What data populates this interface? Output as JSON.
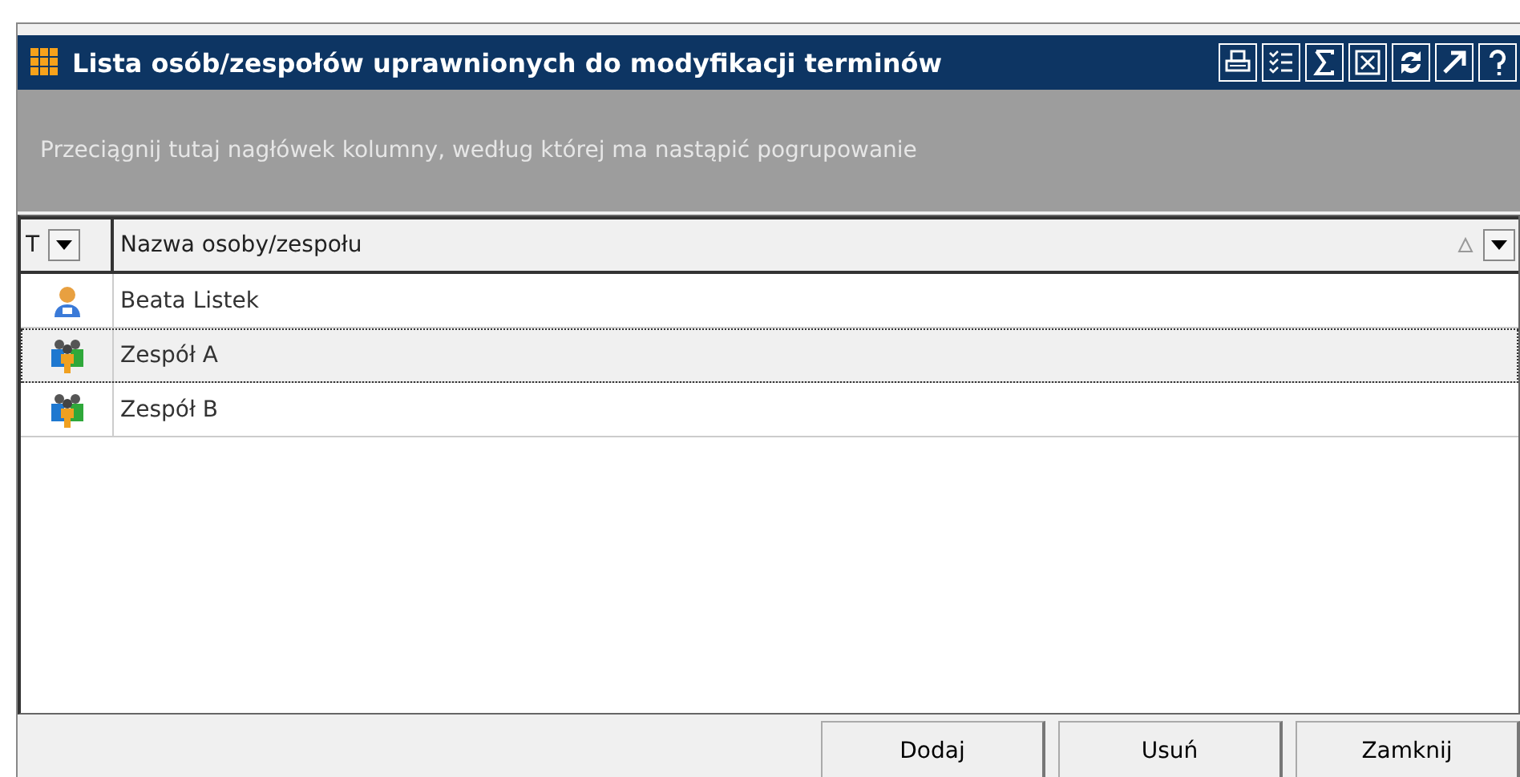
{
  "window": {
    "title": "Lista osób/zespołów uprawnionych do modyfikacji terminów"
  },
  "toolbar": {
    "buttons": [
      {
        "kind": "print"
      },
      {
        "kind": "checklist"
      },
      {
        "kind": "sum"
      },
      {
        "kind": "export"
      },
      {
        "kind": "refresh"
      },
      {
        "kind": "open"
      },
      {
        "kind": "help"
      }
    ]
  },
  "group_panel": {
    "placeholder": "Przeciągnij tutaj nagłówek kolumny, według której ma nastąpić pogrupowanie"
  },
  "table": {
    "columns": [
      {
        "label": "T",
        "sorted_ascending": false
      },
      {
        "label": "Nazwa osoby/zespołu",
        "sorted_ascending": true
      }
    ],
    "rows": [
      {
        "kind": "person",
        "name": "Beata Listek",
        "selected": false
      },
      {
        "kind": "team",
        "name": "Zespół A",
        "selected": true
      },
      {
        "kind": "team",
        "name": "Zespół B",
        "selected": false
      }
    ]
  },
  "buttons": [
    "Dodaj",
    "Usuń",
    "Zamknij"
  ]
}
